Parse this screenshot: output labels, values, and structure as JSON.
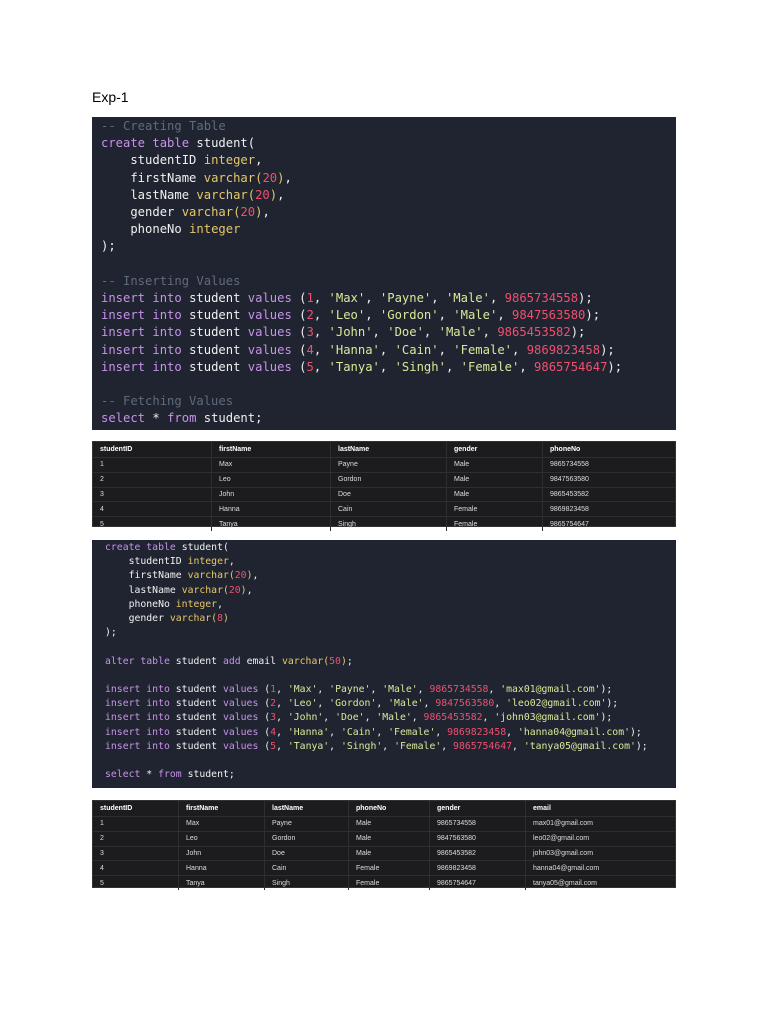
{
  "page_title": "Exp-1",
  "code_block_1": [
    [
      [
        "cm",
        "-- Creating Table"
      ]
    ],
    [
      [
        "kw",
        "create table "
      ],
      [
        "id",
        "student("
      ]
    ],
    [
      [
        "id",
        "    studentID "
      ],
      [
        "ty",
        "integer"
      ],
      [
        "id",
        ","
      ]
    ],
    [
      [
        "id",
        "    firstName "
      ],
      [
        "ty",
        "varchar("
      ],
      [
        "nu",
        "20"
      ],
      [
        "ty",
        ")"
      ],
      [
        "id",
        ","
      ]
    ],
    [
      [
        "id",
        "    lastName "
      ],
      [
        "ty",
        "varchar("
      ],
      [
        "nu",
        "20"
      ],
      [
        "ty",
        ")"
      ],
      [
        "id",
        ","
      ]
    ],
    [
      [
        "id",
        "    gender "
      ],
      [
        "ty",
        "varchar("
      ],
      [
        "nu",
        "20"
      ],
      [
        "ty",
        ")"
      ],
      [
        "id",
        ","
      ]
    ],
    [
      [
        "id",
        "    phoneNo "
      ],
      [
        "ty",
        "integer"
      ]
    ],
    [
      [
        "id",
        ");"
      ]
    ],
    [
      [
        "id",
        " "
      ]
    ],
    [
      [
        "cm",
        "-- Inserting Values"
      ]
    ],
    [
      [
        "kw",
        "insert into "
      ],
      [
        "id",
        "student "
      ],
      [
        "kw",
        "values "
      ],
      [
        "id",
        "("
      ],
      [
        "nu",
        "1"
      ],
      [
        "id",
        ", "
      ],
      [
        "st",
        "'Max'"
      ],
      [
        "id",
        ", "
      ],
      [
        "st",
        "'Payne'"
      ],
      [
        "id",
        ", "
      ],
      [
        "st",
        "'Male'"
      ],
      [
        "id",
        ", "
      ],
      [
        "nu",
        "9865734558"
      ],
      [
        "id",
        ");"
      ]
    ],
    [
      [
        "kw",
        "insert into "
      ],
      [
        "id",
        "student "
      ],
      [
        "kw",
        "values "
      ],
      [
        "id",
        "("
      ],
      [
        "nu",
        "2"
      ],
      [
        "id",
        ", "
      ],
      [
        "st",
        "'Leo'"
      ],
      [
        "id",
        ", "
      ],
      [
        "st",
        "'Gordon'"
      ],
      [
        "id",
        ", "
      ],
      [
        "st",
        "'Male'"
      ],
      [
        "id",
        ", "
      ],
      [
        "nu",
        "9847563580"
      ],
      [
        "id",
        ");"
      ]
    ],
    [
      [
        "kw",
        "insert into "
      ],
      [
        "id",
        "student "
      ],
      [
        "kw",
        "values "
      ],
      [
        "id",
        "("
      ],
      [
        "nu",
        "3"
      ],
      [
        "id",
        ", "
      ],
      [
        "st",
        "'John'"
      ],
      [
        "id",
        ", "
      ],
      [
        "st",
        "'Doe'"
      ],
      [
        "id",
        ", "
      ],
      [
        "st",
        "'Male'"
      ],
      [
        "id",
        ", "
      ],
      [
        "nu",
        "9865453582"
      ],
      [
        "id",
        ");"
      ]
    ],
    [
      [
        "kw",
        "insert into "
      ],
      [
        "id",
        "student "
      ],
      [
        "kw",
        "values "
      ],
      [
        "id",
        "("
      ],
      [
        "nu",
        "4"
      ],
      [
        "id",
        ", "
      ],
      [
        "st",
        "'Hanna'"
      ],
      [
        "id",
        ", "
      ],
      [
        "st",
        "'Cain'"
      ],
      [
        "id",
        ", "
      ],
      [
        "st",
        "'Female'"
      ],
      [
        "id",
        ", "
      ],
      [
        "nu",
        "9869823458"
      ],
      [
        "id",
        ");"
      ]
    ],
    [
      [
        "kw",
        "insert into "
      ],
      [
        "id",
        "student "
      ],
      [
        "kw",
        "values "
      ],
      [
        "id",
        "("
      ],
      [
        "nu",
        "5"
      ],
      [
        "id",
        ", "
      ],
      [
        "st",
        "'Tanya'"
      ],
      [
        "id",
        ", "
      ],
      [
        "st",
        "'Singh'"
      ],
      [
        "id",
        ", "
      ],
      [
        "st",
        "'Female'"
      ],
      [
        "id",
        ", "
      ],
      [
        "nu",
        "9865754647"
      ],
      [
        "id",
        ");"
      ]
    ],
    [
      [
        "id",
        " "
      ]
    ],
    [
      [
        "cm",
        "-- Fetching Values"
      ]
    ],
    [
      [
        "kw",
        "select "
      ],
      [
        "id",
        "* "
      ],
      [
        "kw",
        "from "
      ],
      [
        "id",
        "student;"
      ]
    ]
  ],
  "table_1": {
    "headers": [
      "studentID",
      "firstName",
      "lastName",
      "gender",
      "phoneNo"
    ],
    "rows": [
      [
        "1",
        "Max",
        "Payne",
        "Male",
        "9865734558"
      ],
      [
        "2",
        "Leo",
        "Gordon",
        "Male",
        "9847563580"
      ],
      [
        "3",
        "John",
        "Doe",
        "Male",
        "9865453582"
      ],
      [
        "4",
        "Hanna",
        "Cain",
        "Female",
        "9869823458"
      ],
      [
        "5",
        "Tanya",
        "Singh",
        "Female",
        "9865754647"
      ]
    ]
  },
  "code_block_2": [
    [
      [
        "kw",
        "create table "
      ],
      [
        "id",
        "student("
      ]
    ],
    [
      [
        "id",
        "    studentID "
      ],
      [
        "ty",
        "integer"
      ],
      [
        "id",
        ","
      ]
    ],
    [
      [
        "id",
        "    firstName "
      ],
      [
        "ty",
        "varchar("
      ],
      [
        "nu",
        "20"
      ],
      [
        "ty",
        ")"
      ],
      [
        "id",
        ","
      ]
    ],
    [
      [
        "id",
        "    lastName "
      ],
      [
        "ty",
        "varchar("
      ],
      [
        "nu",
        "20"
      ],
      [
        "ty",
        ")"
      ],
      [
        "id",
        ","
      ]
    ],
    [
      [
        "id",
        "    phoneNo "
      ],
      [
        "ty",
        "integer"
      ],
      [
        "id",
        ","
      ]
    ],
    [
      [
        "id",
        "    gender "
      ],
      [
        "ty",
        "varchar("
      ],
      [
        "nu",
        "8"
      ],
      [
        "ty",
        ")"
      ]
    ],
    [
      [
        "id",
        ");"
      ]
    ],
    [
      [
        "id",
        " "
      ]
    ],
    [
      [
        "kw",
        "alter table "
      ],
      [
        "id",
        "student "
      ],
      [
        "kw",
        "add "
      ],
      [
        "id",
        "email "
      ],
      [
        "ty",
        "varchar("
      ],
      [
        "nu",
        "50"
      ],
      [
        "ty",
        ")"
      ],
      [
        "id",
        ";"
      ]
    ],
    [
      [
        "id",
        " "
      ]
    ],
    [
      [
        "kw",
        "insert into "
      ],
      [
        "id",
        "student "
      ],
      [
        "kw",
        "values "
      ],
      [
        "id",
        "("
      ],
      [
        "nu",
        "1"
      ],
      [
        "id",
        ", "
      ],
      [
        "st",
        "'Max'"
      ],
      [
        "id",
        ", "
      ],
      [
        "st",
        "'Payne'"
      ],
      [
        "id",
        ", "
      ],
      [
        "st",
        "'Male'"
      ],
      [
        "id",
        ", "
      ],
      [
        "nu",
        "9865734558"
      ],
      [
        "id",
        ", "
      ],
      [
        "st",
        "'max01@gmail.com'"
      ],
      [
        "id",
        ");"
      ]
    ],
    [
      [
        "kw",
        "insert into "
      ],
      [
        "id",
        "student "
      ],
      [
        "kw",
        "values "
      ],
      [
        "id",
        "("
      ],
      [
        "nu",
        "2"
      ],
      [
        "id",
        ", "
      ],
      [
        "st",
        "'Leo'"
      ],
      [
        "id",
        ", "
      ],
      [
        "st",
        "'Gordon'"
      ],
      [
        "id",
        ", "
      ],
      [
        "st",
        "'Male'"
      ],
      [
        "id",
        ", "
      ],
      [
        "nu",
        "9847563580"
      ],
      [
        "id",
        ", "
      ],
      [
        "st",
        "'leo02@gmail.com'"
      ],
      [
        "id",
        ");"
      ]
    ],
    [
      [
        "kw",
        "insert into "
      ],
      [
        "id",
        "student "
      ],
      [
        "kw",
        "values "
      ],
      [
        "id",
        "("
      ],
      [
        "nu",
        "3"
      ],
      [
        "id",
        ", "
      ],
      [
        "st",
        "'John'"
      ],
      [
        "id",
        ", "
      ],
      [
        "st",
        "'Doe'"
      ],
      [
        "id",
        ", "
      ],
      [
        "st",
        "'Male'"
      ],
      [
        "id",
        ", "
      ],
      [
        "nu",
        "9865453582"
      ],
      [
        "id",
        ", "
      ],
      [
        "st",
        "'john03@gmail.com'"
      ],
      [
        "id",
        ");"
      ]
    ],
    [
      [
        "kw",
        "insert into "
      ],
      [
        "id",
        "student "
      ],
      [
        "kw",
        "values "
      ],
      [
        "id",
        "("
      ],
      [
        "nu",
        "4"
      ],
      [
        "id",
        ", "
      ],
      [
        "st",
        "'Hanna'"
      ],
      [
        "id",
        ", "
      ],
      [
        "st",
        "'Cain'"
      ],
      [
        "id",
        ", "
      ],
      [
        "st",
        "'Female'"
      ],
      [
        "id",
        ", "
      ],
      [
        "nu",
        "9869823458"
      ],
      [
        "id",
        ", "
      ],
      [
        "st",
        "'hanna04@gmail.com'"
      ],
      [
        "id",
        ");"
      ]
    ],
    [
      [
        "kw",
        "insert into "
      ],
      [
        "id",
        "student "
      ],
      [
        "kw",
        "values "
      ],
      [
        "id",
        "("
      ],
      [
        "nu",
        "5"
      ],
      [
        "id",
        ", "
      ],
      [
        "st",
        "'Tanya'"
      ],
      [
        "id",
        ", "
      ],
      [
        "st",
        "'Singh'"
      ],
      [
        "id",
        ", "
      ],
      [
        "st",
        "'Female'"
      ],
      [
        "id",
        ", "
      ],
      [
        "nu",
        "9865754647"
      ],
      [
        "id",
        ", "
      ],
      [
        "st",
        "'tanya05@gmail.com'"
      ],
      [
        "id",
        ");"
      ]
    ],
    [
      [
        "id",
        " "
      ]
    ],
    [
      [
        "kw",
        "select "
      ],
      [
        "id",
        "* "
      ],
      [
        "kw",
        "from "
      ],
      [
        "id",
        "student;"
      ]
    ]
  ],
  "table_2": {
    "headers": [
      "studentID",
      "firstName",
      "lastName",
      "phoneNo",
      "gender",
      "email"
    ],
    "rows": [
      [
        "1",
        "Max",
        "Payne",
        "Male",
        "9865734558",
        "max01@gmail.com"
      ],
      [
        "2",
        "Leo",
        "Gordon",
        "Male",
        "9847563580",
        "leo02@gmail.com"
      ],
      [
        "3",
        "John",
        "Doe",
        "Male",
        "9865453582",
        "john03@gmail.com"
      ],
      [
        "4",
        "Hanna",
        "Cain",
        "Female",
        "9869823458",
        "hanna04@gmail.com"
      ],
      [
        "5",
        "Tanya",
        "Singh",
        "Female",
        "9865754647",
        "tanya05@gmail.com"
      ]
    ]
  }
}
